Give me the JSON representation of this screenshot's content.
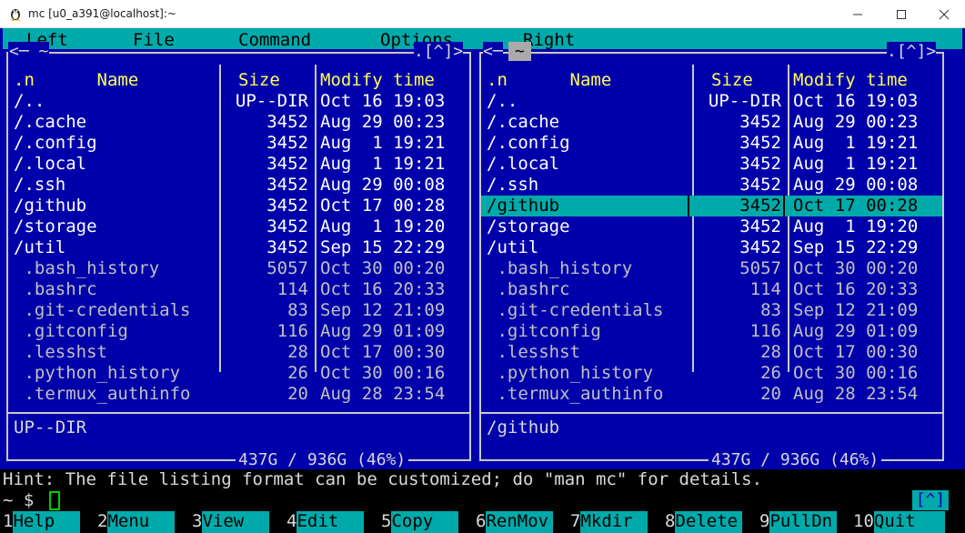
{
  "window": {
    "title": "mc [u0_a391@localhost]:~",
    "icons": {
      "app": "penguin-icon",
      "minimize": "minimize-icon",
      "maximize": "maximize-icon",
      "close": "close-icon"
    }
  },
  "menubar": {
    "items": [
      "Left",
      "File",
      "Command",
      "Options",
      "Right"
    ]
  },
  "colors": {
    "panel_bg": "#0000aa",
    "accent_cyan": "#00aaaa",
    "header_yellow": "#ffff55",
    "cursor_green": "#00cc00"
  },
  "left_panel": {
    "path": "<─ ~",
    "history": ".[^]>",
    "headers": {
      "name": ".n      Name",
      "size": "Size",
      "date": "Modify time"
    },
    "rows": [
      {
        "name": "/..",
        "size": "UP--DIR",
        "date": "Oct 16 19:03",
        "kind": "dir"
      },
      {
        "name": "/.cache",
        "size": "3452",
        "date": "Aug 29 00:23",
        "kind": "dir"
      },
      {
        "name": "/.config",
        "size": "3452",
        "date": "Aug  1 19:21",
        "kind": "dir"
      },
      {
        "name": "/.local",
        "size": "3452",
        "date": "Aug  1 19:21",
        "kind": "dir"
      },
      {
        "name": "/.ssh",
        "size": "3452",
        "date": "Aug 29 00:08",
        "kind": "dir"
      },
      {
        "name": "/github",
        "size": "3452",
        "date": "Oct 17 00:28",
        "kind": "dir"
      },
      {
        "name": "/storage",
        "size": "3452",
        "date": "Aug  1 19:20",
        "kind": "dir"
      },
      {
        "name": "/util",
        "size": "3452",
        "date": "Sep 15 22:29",
        "kind": "dir"
      },
      {
        "name": " .bash_history",
        "size": "5057",
        "date": "Oct 30 00:20",
        "kind": "file"
      },
      {
        "name": " .bashrc",
        "size": "114",
        "date": "Oct 16 20:33",
        "kind": "file"
      },
      {
        "name": " .git-credentials",
        "size": "83",
        "date": "Sep 12 21:09",
        "kind": "file"
      },
      {
        "name": " .gitconfig",
        "size": "116",
        "date": "Aug 29 01:09",
        "kind": "file"
      },
      {
        "name": " .lesshst",
        "size": "28",
        "date": "Oct 17 00:30",
        "kind": "file"
      },
      {
        "name": " .python_history",
        "size": "26",
        "date": "Oct 30 00:16",
        "kind": "file"
      },
      {
        "name": " .termux_authinfo",
        "size": "20",
        "date": "Aug 28 23:54",
        "kind": "file"
      }
    ],
    "mini_status": "UP--DIR",
    "free_space": "437G / 936G (46%)"
  },
  "right_panel": {
    "path": "~",
    "history": ".[^]>",
    "headers": {
      "name": ".n      Name",
      "size": "Size",
      "date": "Modify time"
    },
    "rows": [
      {
        "name": "/..",
        "size": "UP--DIR",
        "date": "Oct 16 19:03",
        "kind": "dir"
      },
      {
        "name": "/.cache",
        "size": "3452",
        "date": "Aug 29 00:23",
        "kind": "dir"
      },
      {
        "name": "/.config",
        "size": "3452",
        "date": "Aug  1 19:21",
        "kind": "dir"
      },
      {
        "name": "/.local",
        "size": "3452",
        "date": "Aug  1 19:21",
        "kind": "dir"
      },
      {
        "name": "/.ssh",
        "size": "3452",
        "date": "Aug 29 00:08",
        "kind": "dir"
      },
      {
        "name": "/github",
        "size": "3452",
        "date": "Oct 17 00:28",
        "kind": "dir",
        "selected": true
      },
      {
        "name": "/storage",
        "size": "3452",
        "date": "Aug  1 19:20",
        "kind": "dir"
      },
      {
        "name": "/util",
        "size": "3452",
        "date": "Sep 15 22:29",
        "kind": "dir"
      },
      {
        "name": " .bash_history",
        "size": "5057",
        "date": "Oct 30 00:20",
        "kind": "file"
      },
      {
        "name": " .bashrc",
        "size": "114",
        "date": "Oct 16 20:33",
        "kind": "file"
      },
      {
        "name": " .git-credentials",
        "size": "83",
        "date": "Sep 12 21:09",
        "kind": "file"
      },
      {
        "name": " .gitconfig",
        "size": "116",
        "date": "Aug 29 01:09",
        "kind": "file"
      },
      {
        "name": " .lesshst",
        "size": "28",
        "date": "Oct 17 00:30",
        "kind": "file"
      },
      {
        "name": " .python_history",
        "size": "26",
        "date": "Oct 30 00:16",
        "kind": "file"
      },
      {
        "name": " .termux_authinfo",
        "size": "20",
        "date": "Aug 28 23:54",
        "kind": "file"
      }
    ],
    "mini_status": "/github",
    "free_space": "437G / 936G (46%)"
  },
  "hint": "Hint: The file listing format can be customized; do \"man mc\" for details.",
  "command_line": {
    "prompt": "~ $",
    "history_button": "[^]"
  },
  "function_keys": [
    {
      "num": "1",
      "label": "Help"
    },
    {
      "num": "2",
      "label": "Menu"
    },
    {
      "num": "3",
      "label": "View"
    },
    {
      "num": "4",
      "label": "Edit"
    },
    {
      "num": "5",
      "label": "Copy"
    },
    {
      "num": "6",
      "label": "RenMov"
    },
    {
      "num": "7",
      "label": "Mkdir"
    },
    {
      "num": "8",
      "label": "Delete"
    },
    {
      "num": "9",
      "label": "PullDn"
    },
    {
      "num": "10",
      "label": "Quit"
    }
  ]
}
